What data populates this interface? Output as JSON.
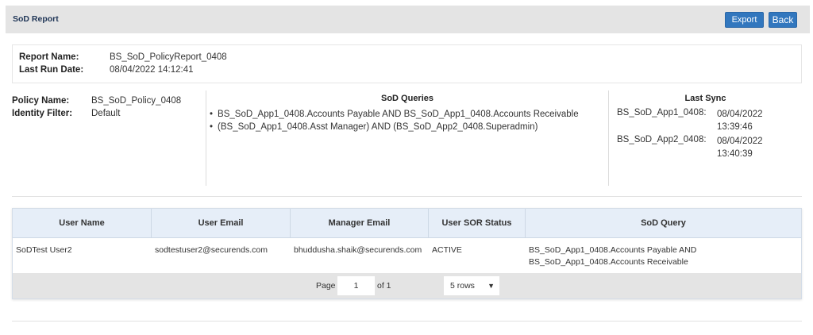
{
  "header": {
    "title": "SoD Report",
    "export_label": "Export",
    "back_label": "Back"
  },
  "report": {
    "name_label": "Report Name:",
    "name_value": "BS_SoD_PolicyReport_0408",
    "last_run_label": "Last Run Date:",
    "last_run_value": "08/04/2022 14:12:41"
  },
  "policy": {
    "name_label": "Policy Name:",
    "name_value": "BS_SoD_Policy_0408",
    "filter_label": "Identity Filter:",
    "filter_value": "Default"
  },
  "queries": {
    "title": "SoD Queries",
    "items": [
      "BS_SoD_App1_0408.Accounts Payable AND BS_SoD_App1_0408.Accounts Receivable",
      "(BS_SoD_App1_0408.Asst Manager) AND (BS_SoD_App2_0408.Superadmin)"
    ]
  },
  "sync": {
    "title": "Last Sync",
    "items": [
      {
        "name": "BS_SoD_App1_0408:",
        "date": "08/04/2022",
        "time": "13:39:46"
      },
      {
        "name": "BS_SoD_App2_0408:",
        "date": "08/04/2022",
        "time": "13:40:39"
      }
    ]
  },
  "table": {
    "headers": [
      "User Name",
      "User Email",
      "Manager Email",
      "User SOR Status",
      "SoD Query"
    ],
    "rows": [
      [
        "SoDTest User2",
        "sodtestuser2@securends.com",
        "bhuddusha.shaik@securends.com",
        "ACTIVE",
        "BS_SoD_App1_0408.Accounts Payable AND BS_SoD_App1_0408.Accounts Receivable"
      ]
    ]
  },
  "pager": {
    "page_label": "Page",
    "page_value": "1",
    "of_label": "of 1",
    "rows_value": "5 rows"
  },
  "colors": {
    "button": "#3277be",
    "header_bg": "#e4e4e4",
    "table_head_bg": "#e6eef8",
    "title_text": "#1f3556"
  }
}
